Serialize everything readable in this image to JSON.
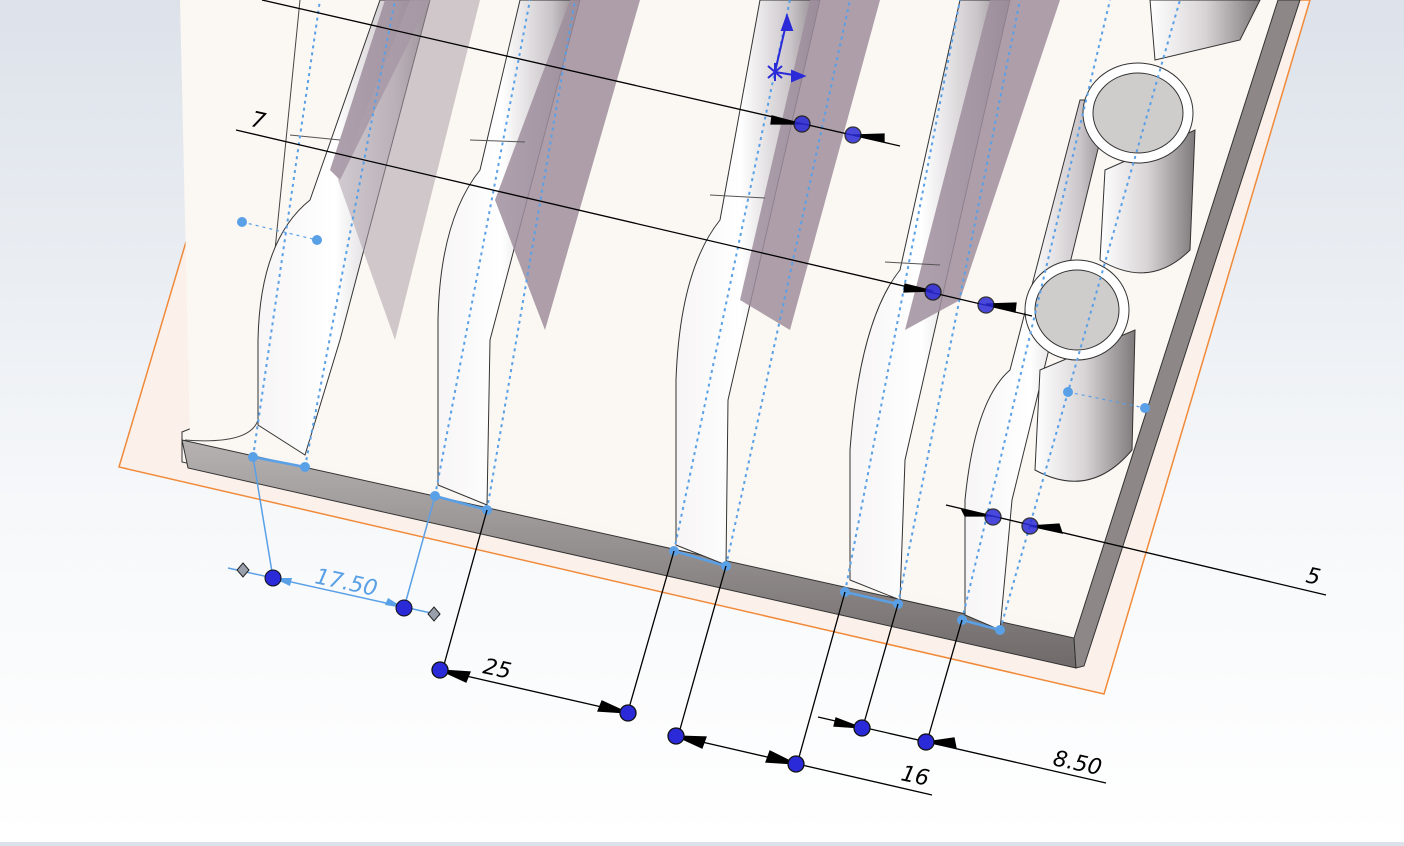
{
  "viewport": {
    "background_top": "#dde2ea",
    "background_bottom": "#ffffff"
  },
  "colors": {
    "sketch_plane": "#f08a3a",
    "plane_fill": "#fbf1ea",
    "sketch_line": "#5aa0e6",
    "dimension_line": "#000000",
    "handle": "#2a2ad8",
    "selected_dimension": "#5aa0e6",
    "rib_shade": "#9f8e9e"
  },
  "dimensions": [
    {
      "id": "dim-17-50",
      "value": "17.50",
      "selected": true
    },
    {
      "id": "dim-25",
      "value": "25",
      "selected": false
    },
    {
      "id": "dim-16",
      "value": "16",
      "selected": false
    },
    {
      "id": "dim-8-50",
      "value": "8.50",
      "selected": false
    },
    {
      "id": "dim-5",
      "value": "5",
      "selected": false
    },
    {
      "id": "dim-7",
      "value": "7",
      "selected": false
    }
  ],
  "icons": {
    "triad": "sketch-origin-triad-icon",
    "handle": "dimension-drag-handle-icon"
  }
}
